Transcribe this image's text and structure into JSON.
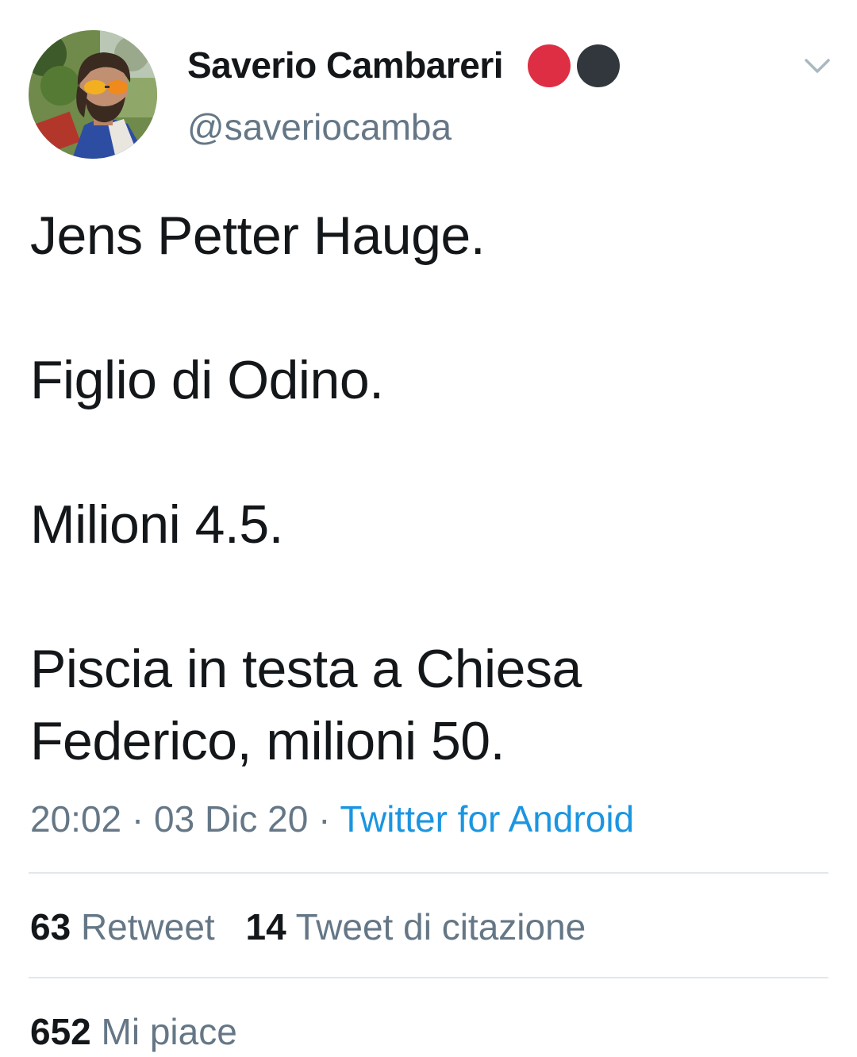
{
  "tweet": {
    "author": {
      "display_name": "Saverio Cambareri",
      "handle": "@saveriocamba",
      "name_emojis": [
        "red-circle",
        "black-circle"
      ]
    },
    "text_lines": [
      "Jens Petter Hauge.",
      "Figlio di Odino.",
      "Milioni 4.5.",
      "Piscia in testa a Chiesa",
      "Federico, milioni 50."
    ],
    "time": "20:02",
    "separator": "·",
    "date": "03 Dic 20",
    "source": "Twitter for Android",
    "stats": {
      "retweets_count": "63",
      "retweets_label": "Retweet",
      "quotes_count": "14",
      "quotes_label": "Tweet di citazione",
      "likes_count": "652",
      "likes_label": "Mi piace"
    }
  },
  "colors": {
    "text_primary": "#14171a",
    "text_secondary": "#657786",
    "link": "#1b95e0",
    "divider": "#e1e8ed",
    "emoji_red": "#dd2e44",
    "emoji_black": "#31373d"
  },
  "icons": [
    "avatar",
    "chevron-down-icon"
  ]
}
